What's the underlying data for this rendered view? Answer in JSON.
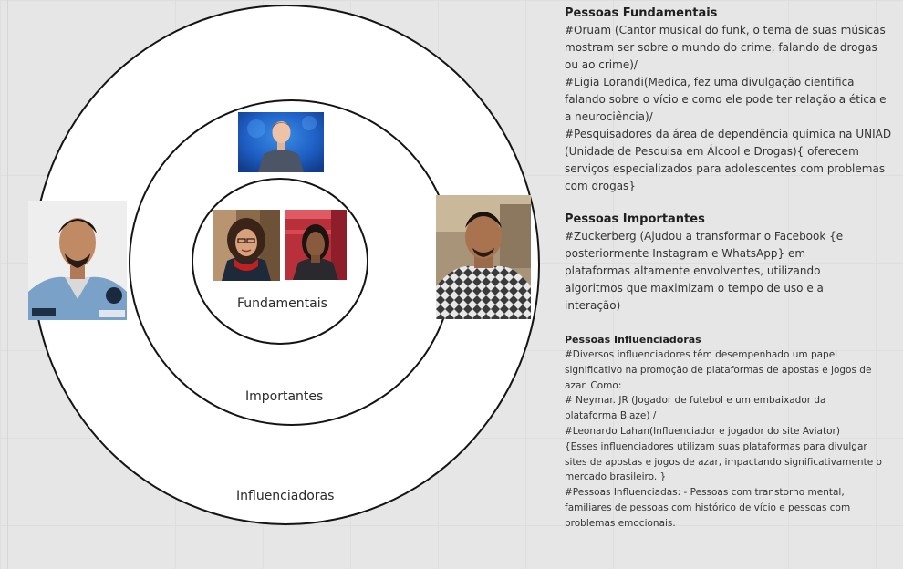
{
  "diagram": {
    "rings": {
      "fundamentais": "Fundamentais",
      "importantes": "Importantes",
      "influenciadoras": "Influenciadoras"
    },
    "colors": {
      "ring_stroke": "#141414",
      "ring_fill": "#ffffff",
      "board": "#e6e6e6"
    }
  },
  "text_panel": {
    "fundamentais": {
      "title": "Pessoas Fundamentais",
      "body": "#Oruam (Cantor musical do funk, o tema de suas músicas\nmostram ser sobre o mundo do crime, falando de drogas\nou ao crime)/\n#Ligia Lorandi(Medica, fez uma divulgação cientifica\nfalando sobre o vício e como ele pode ter relação a ética e\na neurociência)/\n#Pesquisadores da área de dependência química na UNIAD\n(Unidade de Pesquisa em Álcool e Drogas){ oferecem\nserviços especializados para adolescentes com problemas\ncom drogas}"
    },
    "importantes": {
      "title": "Pessoas Importantes",
      "body": "#Zuckerberg (Ajudou a transformar o Facebook {e\nposteriormente Instagram e WhatsApp} em\nplataformas altamente envolventes, utilizando\nalgoritmos que maximizam o tempo de uso e a\ninteração)"
    },
    "influenciadoras": {
      "title": "Pessoas Influenciadoras",
      "body": "#Diversos influenciadores têm desempenhado um papel\nsignificativo na promoção de plataformas de apostas e jogos de\nazar. Como:\n# Neymar. JR (Jogador de futebol e um embaixador da\nplataforma Blaze) /\n#Leonardo Lahan(Influenciador e jogador do site Aviator)\n{Esses influenciadores utilizam suas plataformas para divulgar\nsites de apostas e jogos de azar, impactando significativamente o\nmercado brasileiro. }\n#Pessoas Influenciadas: - Pessoas com transtorno mental,\nfamiliares de pessoas com histórico de vício e pessoas com\nproblemas emocionais."
    }
  }
}
